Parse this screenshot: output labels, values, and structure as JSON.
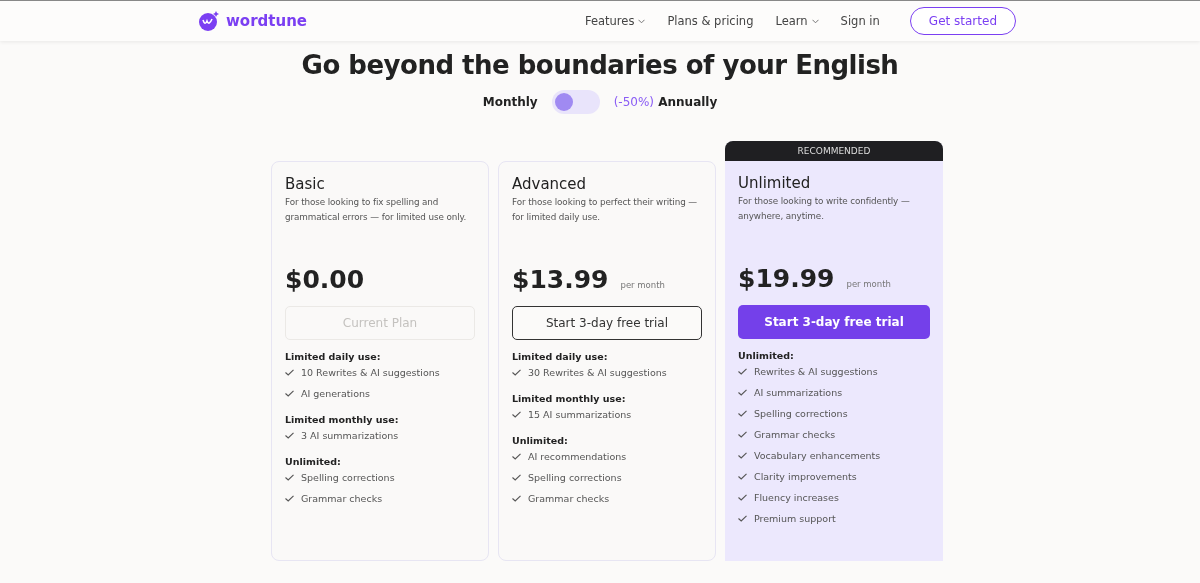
{
  "nav": {
    "logo": "wordtune",
    "links": [
      {
        "label": "Features",
        "dropdown": true
      },
      {
        "label": "Plans & pricing",
        "dropdown": false
      },
      {
        "label": "Learn",
        "dropdown": true
      },
      {
        "label": "Sign in",
        "dropdown": false
      }
    ],
    "cta": "Get started"
  },
  "headline": "Go beyond the boundaries of your English",
  "billing": {
    "left": "Monthly",
    "discount": "(-50%)",
    "right": "Annually",
    "on": false
  },
  "plans": [
    {
      "name": "Basic",
      "recommended": false,
      "description": "For those looking to fix spelling and grammatical errors — for limited use only.",
      "price": "$0.00",
      "button": {
        "label": "Current Plan",
        "kind": "disabled"
      },
      "sections": [
        {
          "heading": "Limited daily use:",
          "items": [
            "10 Rewrites & AI suggestions",
            "AI generations"
          ]
        },
        {
          "heading": "Limited monthly use:",
          "items": [
            "3 AI summarizations"
          ]
        },
        {
          "heading": "Unlimited:",
          "items": [
            "Spelling corrections",
            "Grammar checks"
          ]
        }
      ]
    },
    {
      "name": "Advanced",
      "recommended": false,
      "description": "For those looking to perfect their writing — for limited daily use.",
      "price": "$13.99",
      "period": "per month",
      "button": {
        "label": "Start 3-day free trial",
        "kind": "outline"
      },
      "sections": [
        {
          "heading": "Limited daily use:",
          "items": [
            "30 Rewrites & AI suggestions"
          ]
        },
        {
          "heading": "Limited monthly use:",
          "items": [
            "15 AI summarizations"
          ]
        },
        {
          "heading": "Unlimited:",
          "items": [
            "AI recommendations",
            "Spelling corrections",
            "Grammar checks"
          ]
        }
      ]
    },
    {
      "name": "Unlimited",
      "recommended": true,
      "badge": "RECOMMENDED",
      "description": "For those looking to write confidently — anywhere, anytime.",
      "price": "$19.99",
      "period": "per month",
      "button": {
        "label": "Start 3-day free trial",
        "kind": "primary"
      },
      "sections": [
        {
          "heading": "Unlimited:",
          "items": [
            "Rewrites & AI suggestions",
            "AI summarizations",
            "Spelling corrections",
            "Grammar checks",
            "Vocabulary enhancements",
            "Clarity improvements",
            "Fluency increases",
            "Premium support"
          ]
        }
      ]
    }
  ]
}
